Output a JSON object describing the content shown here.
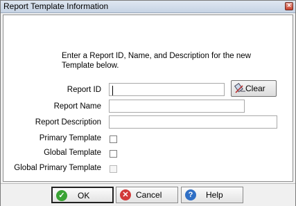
{
  "window": {
    "title": "Report Template Information",
    "close_label": "×"
  },
  "intro_text": "Enter a Report ID, Name, and Description for the new Template below.",
  "form": {
    "report_id": {
      "label": "Report ID",
      "value": ""
    },
    "report_name": {
      "label": "Report Name",
      "value": ""
    },
    "report_description": {
      "label": "Report Description",
      "value": ""
    },
    "primary_template": {
      "label": "Primary Template",
      "checked": false,
      "enabled": true
    },
    "global_template": {
      "label": "Global Template",
      "checked": false,
      "enabled": true
    },
    "global_primary_template": {
      "label": "Global Primary Template",
      "checked": false,
      "enabled": false
    },
    "clear_label": "Clear"
  },
  "footer": {
    "ok_label": "OK",
    "cancel_label": "Cancel",
    "help_label": "Help"
  },
  "colors": {
    "ok_icon": "#3aa335",
    "cancel_icon": "#d23a3a",
    "help_icon": "#2f6fc5"
  },
  "icons": {
    "clear": "eraser-icon",
    "ok": "check-circle-icon",
    "cancel": "x-circle-icon",
    "help": "question-circle-icon"
  }
}
